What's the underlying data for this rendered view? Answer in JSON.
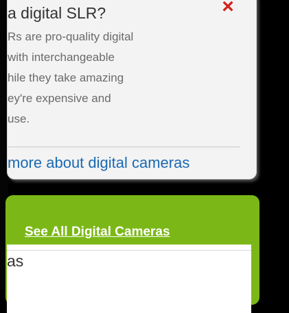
{
  "tooltip": {
    "title": "a digital SLR?",
    "close_icon": "×",
    "body_lines": [
      "Rs are pro-quality digital",
      "with interchangeable",
      "hile they take amazing",
      "ey're expensive and",
      "use."
    ],
    "learn_more_link": "more about digital cameras"
  },
  "panel": {
    "see_all_link": "See All Digital Cameras",
    "section_text": "as"
  }
}
